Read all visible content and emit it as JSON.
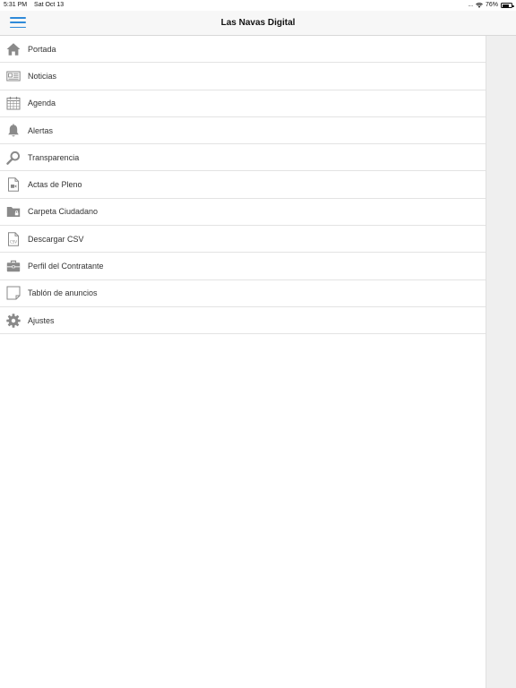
{
  "status_bar": {
    "time": "5:31 PM",
    "date": "Sat Oct 13",
    "signal": "....",
    "battery_percent": "76%",
    "battery_level": 0.76
  },
  "header": {
    "title": "Las Navas Digital",
    "menu_icon": "hamburger-icon",
    "accent_color": "#2f8ad9"
  },
  "menu": {
    "items": [
      {
        "label": "Portada",
        "icon": "home-icon"
      },
      {
        "label": "Noticias",
        "icon": "newspaper-icon"
      },
      {
        "label": "Agenda",
        "icon": "calendar-icon"
      },
      {
        "label": "Alertas",
        "icon": "bell-icon"
      },
      {
        "label": "Transparencia",
        "icon": "search-icon"
      },
      {
        "label": "Actas de Pleno",
        "icon": "video-document-icon"
      },
      {
        "label": "Carpeta Ciudadano",
        "icon": "folder-lock-icon"
      },
      {
        "label": "Descargar CSV",
        "icon": "csv-file-icon"
      },
      {
        "label": "Perfil del Contratante",
        "icon": "briefcase-icon"
      },
      {
        "label": "Tablón de anuncios",
        "icon": "note-icon"
      },
      {
        "label": "Ajustes",
        "icon": "gear-icon"
      }
    ]
  }
}
